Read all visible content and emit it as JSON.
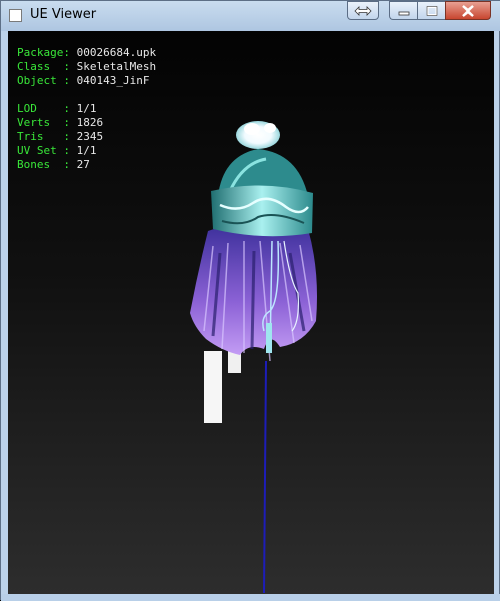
{
  "window": {
    "title": "UE Viewer"
  },
  "info": {
    "package": {
      "label": "Package:",
      "value": "00026684.upk"
    },
    "class": {
      "label": "Class  :",
      "value": "SkeletalMesh"
    },
    "object": {
      "label": "Object :",
      "value": "040143_JinF"
    },
    "lod": {
      "label": "LOD    :",
      "value": "1/1"
    },
    "verts": {
      "label": "Verts  :",
      "value": "1826"
    },
    "tris": {
      "label": "Tris   :",
      "value": "2345"
    },
    "uvset": {
      "label": "UV Set :",
      "value": "1/1"
    },
    "bones": {
      "label": "Bones  :",
      "value": "27"
    }
  },
  "icons": {
    "app": "app-icon",
    "swap": "swap-arrows-icon",
    "minimize": "minimize-icon",
    "maximize": "maximize-icon",
    "close": "close-icon"
  }
}
